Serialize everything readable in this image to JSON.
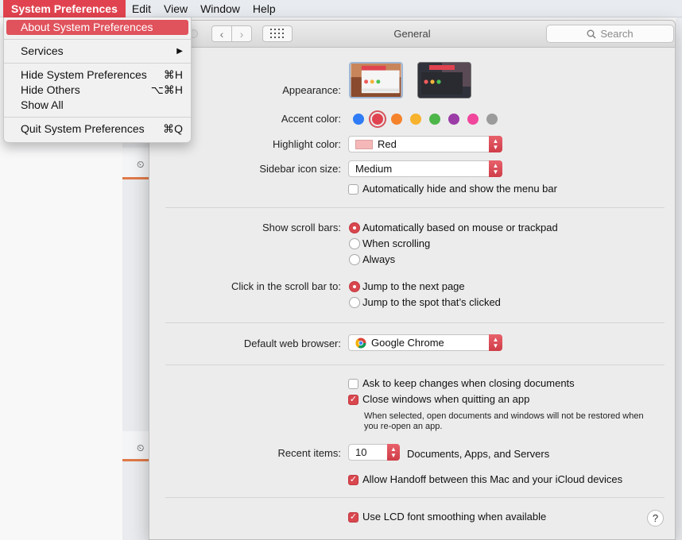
{
  "menubar": {
    "app": "System Preferences",
    "items": [
      "Edit",
      "View",
      "Window",
      "Help"
    ]
  },
  "app_menu": {
    "about": "About System Preferences",
    "services": "Services",
    "hide": "Hide System Preferences",
    "hide_shortcut": "⌘H",
    "hide_others": "Hide Others",
    "hide_others_shortcut": "⌥⌘H",
    "show_all": "Show All",
    "quit": "Quit System Preferences",
    "quit_shortcut": "⌘Q"
  },
  "window": {
    "title": "General",
    "search_placeholder": "Search"
  },
  "general": {
    "appearance_label": "Appearance:",
    "accent_label": "Accent color:",
    "accent_colors": [
      "#2f7cf6",
      "#e0434f",
      "#f5832b",
      "#f7b22e",
      "#4db649",
      "#9b3ca7",
      "#f0479c",
      "#9b9b9b"
    ],
    "accent_selected": "#e0434f",
    "highlight_label": "Highlight color:",
    "highlight_value": "Red",
    "sidebar_label": "Sidebar icon size:",
    "sidebar_value": "Medium",
    "autohide_menu": "Automatically hide and show the menu bar",
    "scrollbars_label": "Show scroll bars:",
    "scroll_auto": "Automatically based on mouse or trackpad",
    "scroll_when": "When scrolling",
    "scroll_always": "Always",
    "click_label": "Click in the scroll bar to:",
    "click_next": "Jump to the next page",
    "click_spot": "Jump to the spot that’s clicked",
    "browser_label": "Default web browser:",
    "browser_value": "Google Chrome",
    "ask_keep": "Ask to keep changes when closing documents",
    "close_windows": "Close windows when quitting an app",
    "close_note": "When selected, open documents and windows will not be restored when you re-open an app.",
    "recent_label": "Recent items:",
    "recent_value": "10",
    "recent_suffix": "Documents, Apps, and Servers",
    "handoff": "Allow Handoff between this Mac and your iCloud devices",
    "lcd": "Use LCD font smoothing when available",
    "help": "?"
  }
}
